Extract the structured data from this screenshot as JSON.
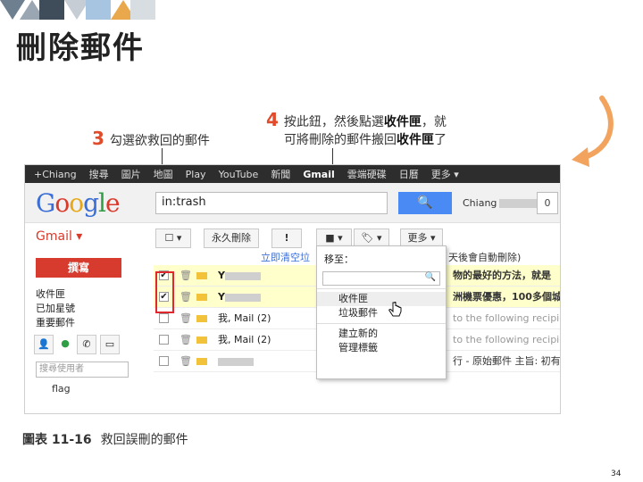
{
  "slide": {
    "title": "刪除郵件",
    "page_number": "34"
  },
  "annotations": {
    "step3_num": "3",
    "step3_text": "勾選欲救回的郵件",
    "step4_num": "4",
    "step4_line1_a": "按此鈕，然後點選",
    "step4_line1_b": "收件匣",
    "step4_line1_c": "，就",
    "step4_line2_a": "可將刪除的郵件搬回",
    "step4_line2_b": "收件匣",
    "step4_line2_c": "了"
  },
  "gmail": {
    "topbar": [
      "+Chiang",
      "搜尋",
      "圖片",
      "地圖",
      "Play",
      "YouTube",
      "新聞",
      "Gmail",
      "雲端硬碟",
      "日曆",
      "更多 ▾"
    ],
    "logo": [
      "G",
      "o",
      "o",
      "g",
      "l",
      "e"
    ],
    "search_value": "in:trash",
    "search_icon": "🔍",
    "user": "Chiang",
    "user_count": "0",
    "gmail_label": "Gmail ▾",
    "buttons": {
      "select": "☐ ▾",
      "delete_forever": "永久刪除",
      "spam": "!",
      "move": "■ ▾",
      "labels": "🏷 ▾",
      "more": "更多 ▾"
    },
    "compose": "撰寫",
    "nav": [
      "收件匣",
      "已加星號",
      "重要郵件"
    ],
    "people_search": "搜尋使用者",
    "flag": "flag",
    "notice_link": "立即清空垃",
    "notice_rest": "天後會自動刪除)",
    "rows": [
      {
        "sender": "Y",
        "snippet": "物的最好的方法，就是",
        "checked": "✔",
        "selected": true,
        "bold": true
      },
      {
        "sender": "Y",
        "snippet": "洲機票優惠，100多個城",
        "checked": "✔",
        "selected": true,
        "bold": true
      },
      {
        "sender": "我, Mail (2)",
        "snippet": "to the following recipien",
        "checked": "",
        "selected": false,
        "bold": false
      },
      {
        "sender": "我, Mail (2)",
        "snippet": "to the following recipien",
        "checked": "",
        "selected": false,
        "bold": false
      },
      {
        "sender": "",
        "snippet": "行 - 原始郵件 主旨: 初有",
        "checked": "",
        "selected": false,
        "bold": false
      }
    ],
    "popup": {
      "header": "移至：",
      "search_icon": "🔍",
      "items": [
        "收件匣",
        "垃圾郵件",
        "建立新的",
        "管理標籤"
      ]
    }
  },
  "caption": {
    "label": "圖表 11-16",
    "text": "救回誤刪的郵件"
  }
}
